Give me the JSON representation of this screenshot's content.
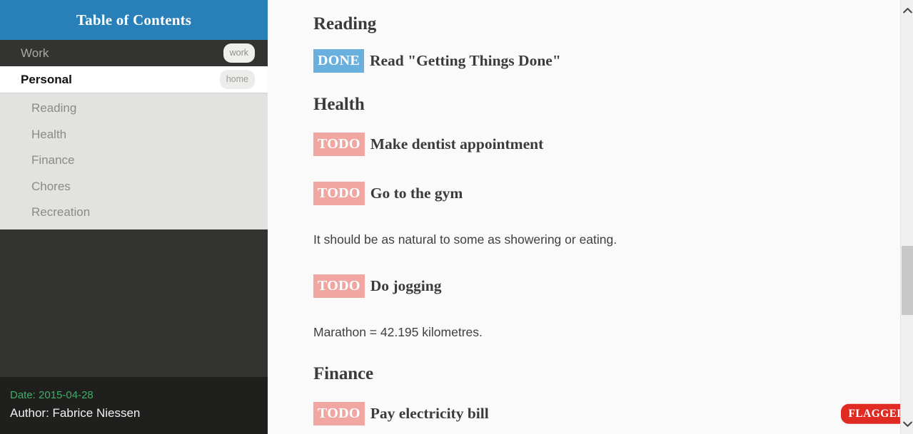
{
  "sidebar": {
    "header_title": "Table of Contents",
    "top_items": [
      {
        "label": "Work",
        "tag": "work",
        "active": false
      },
      {
        "label": "Personal",
        "tag": "home",
        "active": true
      }
    ],
    "sub_items": [
      {
        "label": "Reading"
      },
      {
        "label": "Health"
      },
      {
        "label": "Finance"
      },
      {
        "label": "Chores"
      },
      {
        "label": "Recreation"
      }
    ],
    "footer": {
      "date": "Date: 2015-04-28",
      "author": "Author: Fabrice Niessen"
    }
  },
  "content": {
    "sections": [
      {
        "heading": "Reading",
        "tasks": [
          {
            "keyword": "DONE",
            "text": "Read \"Getting Things Done\"",
            "flag": null
          }
        ]
      },
      {
        "heading": "Health",
        "tasks": [
          {
            "keyword": "TODO",
            "text": "Make dentist appointment",
            "flag": null
          },
          {
            "keyword": "TODO",
            "text": "Go to the gym",
            "flag": null
          },
          {
            "keyword": "TODO",
            "text": "Do jogging",
            "flag": null
          }
        ],
        "paragraphs": [
          "It should be as natural to some as showering or eating.",
          "Marathon = 42.195 kilometres."
        ]
      },
      {
        "heading": "Finance",
        "tasks": [
          {
            "keyword": "TODO",
            "text": "Pay electricity bill",
            "flag": "FLAGGED"
          }
        ]
      }
    ],
    "headings": {
      "reading": "Reading",
      "health": "Health",
      "finance": "Finance"
    },
    "tasks": {
      "reading_1_kw": "DONE",
      "reading_1_text": "Read \"Getting Things Done\"",
      "health_1_kw": "TODO",
      "health_1_text": "Make dentist appointment",
      "health_2_kw": "TODO",
      "health_2_text": "Go to the gym",
      "health_3_kw": "TODO",
      "health_3_text": "Do jogging",
      "finance_1_kw": "TODO",
      "finance_1_text": "Pay electricity bill",
      "finance_1_flag": "FLAGGED"
    },
    "paragraphs": {
      "health_1": "It should be as natural to some as showering or eating.",
      "health_2": "Marathon = 42.195 kilometres."
    }
  },
  "scrollbar": {
    "up_icon": "chevron-up-icon",
    "down_icon": "chevron-down-icon"
  },
  "colors": {
    "header_blue": "#2980b9",
    "sidebar_dark": "#333331",
    "footer_dark": "#1f1f1e",
    "sub_list_gray": "#e2e2e1",
    "done_badge": "#6ab0de",
    "todo_badge": "#f2a6a1",
    "flag_badge": "#e02a22",
    "date_green": "#3fae68",
    "content_bg": "#fafafa"
  }
}
